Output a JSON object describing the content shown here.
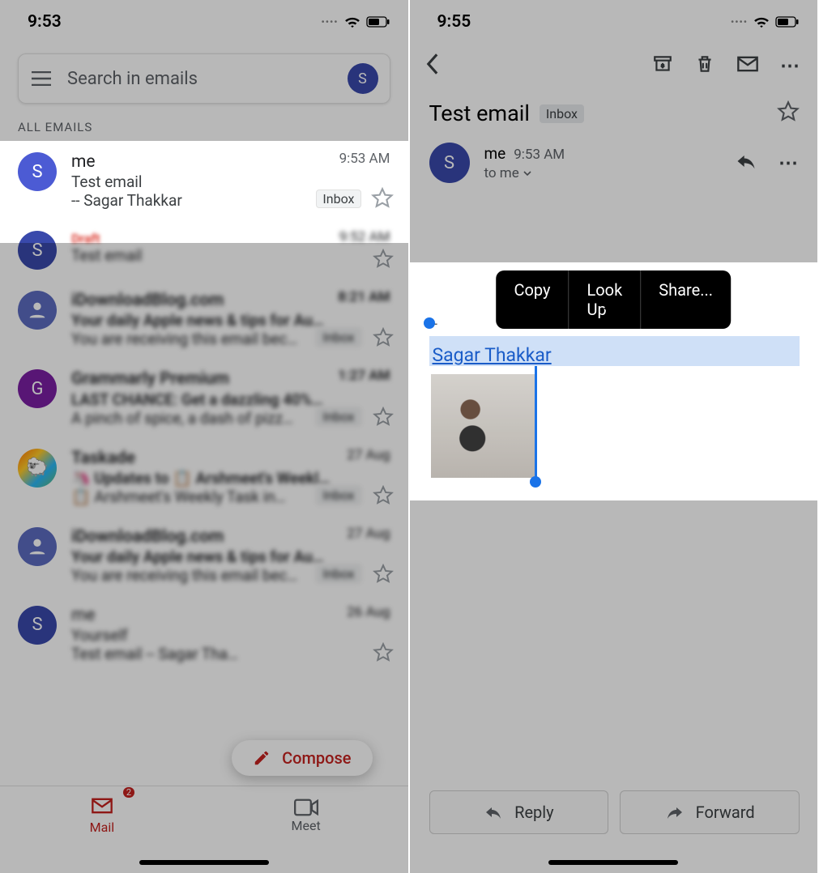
{
  "left": {
    "time": "9:53",
    "search_placeholder": "Search in emails",
    "avatar_letter": "S",
    "section_label": "ALL EMAILS",
    "highlight_row": {
      "avatar_letter": "S",
      "sender": "me",
      "time": "9:53 AM",
      "subject": "Test email",
      "snippet": "-- Sagar Thakkar",
      "tag": "Inbox"
    },
    "blur_rows": [
      {
        "avatar_letter": "S",
        "avatar_color": "#3949ab",
        "sender": "Draft",
        "subject": "Test email",
        "time": "9:52 AM",
        "snippet": "",
        "draft": true
      },
      {
        "avatar_letter": "",
        "avatar_color": "#bdbdbd",
        "sender": "iDownloadBlog.com",
        "subject": "Your daily Apple news & tips for Au…",
        "time": "8:21 AM",
        "snippet": "You are receiving this email bec…",
        "tag": "Inbox"
      },
      {
        "avatar_letter": "G",
        "avatar_color": "#7b1fa2",
        "sender": "Grammarly Premium",
        "subject": "LAST CHANCE: Get a dazzling 40%…",
        "time": "1:27 AM",
        "snippet": "A pinch of spice, a dash of pizz…",
        "tag": "Inbox"
      },
      {
        "avatar_letter": "",
        "avatar_color": "#ffb300",
        "sender": "Taskade",
        "subject": "🦄 Updates to 📋 Arshmeet's Weekl…",
        "time": "27 Aug",
        "snippet": "📋 Arshmeet's Weekly Task in…",
        "tag": "Inbox"
      },
      {
        "avatar_letter": "",
        "avatar_color": "#bdbdbd",
        "sender": "iDownloadBlog.com",
        "subject": "Your daily Apple news & tips for Au…",
        "time": "27 Aug",
        "snippet": "You are receiving this email bec…",
        "tag": "Inbox"
      },
      {
        "avatar_letter": "S",
        "avatar_color": "#3949ab",
        "sender": "me",
        "subject": "Yourself",
        "time": "26 Aug",
        "snippet": "Test email  -- Sagar Tha…"
      }
    ],
    "compose": "Compose",
    "tab_mail": "Mail",
    "mail_badge": "2",
    "tab_meet": "Meet"
  },
  "right": {
    "time": "9:55",
    "subject": "Test email",
    "chip": "Inbox",
    "sender_name": "me",
    "sender_time": "9:53 AM",
    "to_line": "to me",
    "menu": {
      "copy": "Copy",
      "lookup": "Look Up",
      "share": "Share..."
    },
    "dashes": "--",
    "link_text": "Sagar Thakkar",
    "reply": "Reply",
    "forward": "Forward"
  }
}
